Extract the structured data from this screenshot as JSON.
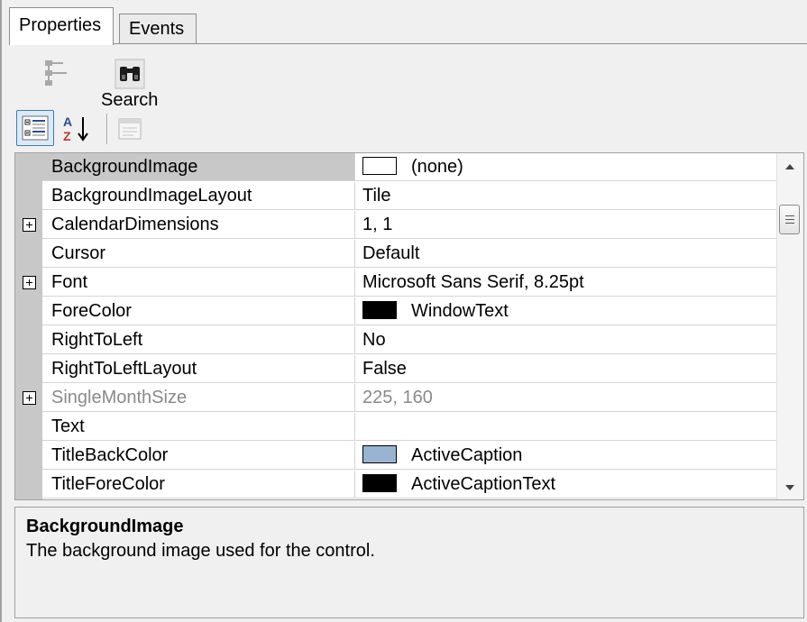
{
  "tabs": [
    {
      "label": "Properties",
      "active": true
    },
    {
      "label": "Events",
      "active": false
    }
  ],
  "toolbar": {
    "items": [
      {
        "icon": "hierarchy-icon",
        "label": ""
      },
      {
        "icon": "binoculars-icon",
        "label": "Search"
      }
    ],
    "view_buttons": [
      {
        "icon": "categorized-icon",
        "active": true
      },
      {
        "icon": "alphabetical-sort-icon",
        "active": false
      },
      {
        "icon": "property-pages-icon",
        "active": false
      }
    ]
  },
  "properties": [
    {
      "name": "BackgroundImage",
      "value": "(none)",
      "swatch": "#ffffff",
      "expandable": false,
      "selected": true,
      "disabled": false
    },
    {
      "name": "BackgroundImageLayout",
      "value": "Tile",
      "swatch": null,
      "expandable": false,
      "selected": false,
      "disabled": false
    },
    {
      "name": "CalendarDimensions",
      "value": "1, 1",
      "swatch": null,
      "expandable": true,
      "selected": false,
      "disabled": false
    },
    {
      "name": "Cursor",
      "value": "Default",
      "swatch": null,
      "expandable": false,
      "selected": false,
      "disabled": false
    },
    {
      "name": "Font",
      "value": "Microsoft Sans Serif, 8.25pt",
      "swatch": null,
      "expandable": true,
      "selected": false,
      "disabled": false
    },
    {
      "name": "ForeColor",
      "value": "WindowText",
      "swatch": "#000000",
      "expandable": false,
      "selected": false,
      "disabled": false
    },
    {
      "name": "RightToLeft",
      "value": "No",
      "swatch": null,
      "expandable": false,
      "selected": false,
      "disabled": false
    },
    {
      "name": "RightToLeftLayout",
      "value": "False",
      "swatch": null,
      "expandable": false,
      "selected": false,
      "disabled": false
    },
    {
      "name": "SingleMonthSize",
      "value": "225, 160",
      "swatch": null,
      "expandable": true,
      "selected": false,
      "disabled": true
    },
    {
      "name": "Text",
      "value": "",
      "swatch": null,
      "expandable": false,
      "selected": false,
      "disabled": false
    },
    {
      "name": "TitleBackColor",
      "value": "ActiveCaption",
      "swatch": "#99b4d1",
      "expandable": false,
      "selected": false,
      "disabled": false
    },
    {
      "name": "TitleForeColor",
      "value": "ActiveCaptionText",
      "swatch": "#000000",
      "expandable": false,
      "selected": false,
      "disabled": false
    }
  ],
  "help": {
    "title": "BackgroundImage",
    "description": "The background image used for the control."
  }
}
